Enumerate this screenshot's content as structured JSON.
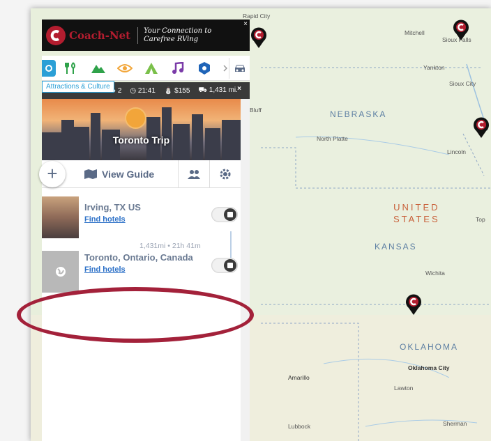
{
  "ad": {
    "brand": "Coach-Net",
    "tagline_1": "Your Connection to",
    "tagline_2": "Carefree RVing",
    "close": "×"
  },
  "categories": {
    "tooltip": "Attractions & Culture",
    "icons": [
      "camera-icon",
      "restaurant-icon",
      "mountain-icon",
      "eye-icon",
      "campground-icon",
      "music-icon",
      "shield-icon",
      "chevron-right-icon",
      "car-icon"
    ],
    "active_color": "#2a9fd6"
  },
  "trip_header": {
    "stops": "2",
    "time": "21:41",
    "cost": "$155",
    "distance": "1,431 mi.",
    "close": "×"
  },
  "trip": {
    "title": "Toronto Trip",
    "view_guide": "View Guide"
  },
  "stops": [
    {
      "name": "Irving, TX US",
      "hotels": "Find hotels"
    },
    {
      "name": "Toronto, Ontario, Canada",
      "hotels": "Find hotels"
    }
  ],
  "leg": "1,431mi • 21h 41m",
  "map": {
    "states": [
      "NEBRASKA",
      "KANSAS",
      "OKLAHOMA"
    ],
    "country_1": "UNITED",
    "country_2": "STATES",
    "cities": [
      "Mitchell",
      "Sioux Falls",
      "Yankton",
      "Sioux City",
      "North Platte",
      "Lincoln",
      "Wichita",
      "Oklahoma City",
      "Amarillo",
      "Lawton",
      "Lubbock",
      "Sherman",
      "Top",
      "Rapid City",
      "Bluff"
    ]
  },
  "colors": {
    "accent": "#2a9fd6",
    "brand_red": "#b31d2f",
    "highlight": "#a3213a"
  }
}
